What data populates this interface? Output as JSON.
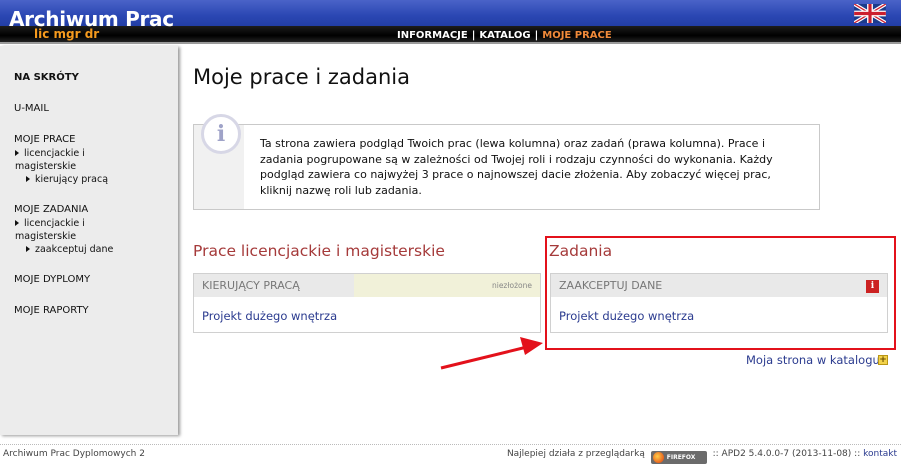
{
  "header": {
    "title": "Archiwum Prac",
    "subtitle": "lic mgr dr",
    "nav": [
      {
        "label": "INFORMACJE",
        "active": false
      },
      {
        "label": "KATALOG",
        "active": false
      },
      {
        "label": "MOJE PRACE",
        "active": true
      }
    ],
    "nav_separator": "|",
    "language_flag": "uk-flag-icon"
  },
  "sidebar": {
    "items": [
      {
        "label": "NA SKRÓTY"
      },
      {
        "label": "U-MAIL"
      },
      {
        "label": "MOJE PRACE",
        "sub": "licencjackie i magisterskie",
        "sub2": "kierujący pracą"
      },
      {
        "label": "MOJE ZADANIA",
        "sub": "licencjackie i magisterskie",
        "sub2": "zaakceptuj dane"
      },
      {
        "label": "MOJE DYPLOMY"
      },
      {
        "label": "MOJE RAPORTY"
      }
    ]
  },
  "main": {
    "title": "Moje prace i zadania",
    "info_text": "Ta strona zawiera podgląd Twoich prac (lewa kolumna) oraz zadań (prawa kolumna). Prace i zadania pogrupowane są w zależności od Twojej roli i rodzaju czynności do wykonania. Każdy podgląd zawiera co najwyżej 3 prace o najnowszej dacie złożenia. Aby zobaczyć więcej prac, kliknij nazwę roli lub zadania.",
    "left_section": {
      "title": "Prace licencjackie i magisterskie",
      "role": "KIERUJĄCY PRACĄ",
      "status": "niezłożone",
      "item": "Projekt dużego wnętrza"
    },
    "right_section": {
      "title": "Zadania",
      "task": "ZAAKCEPTUJ DANE",
      "info_icon": "i",
      "item": "Projekt dużego wnętrza"
    },
    "catalog_link": "Moja strona w katalogu",
    "highlight_color": "#e3111b"
  },
  "footer": {
    "left": "Archiwum Prac Dyplomowych 2",
    "best_with": "Najlepiej działa z przeglądarką",
    "browser_badge": "FIREFOX",
    "version": ":: APD2 5.4.0.0-7 (2013-11-08) ::",
    "contact": "kontakt"
  },
  "colors": {
    "header_blue": "#2b47b3",
    "accent_orange": "#f08a3a",
    "section_title": "#a53a3a",
    "link": "#2b3b8f"
  }
}
